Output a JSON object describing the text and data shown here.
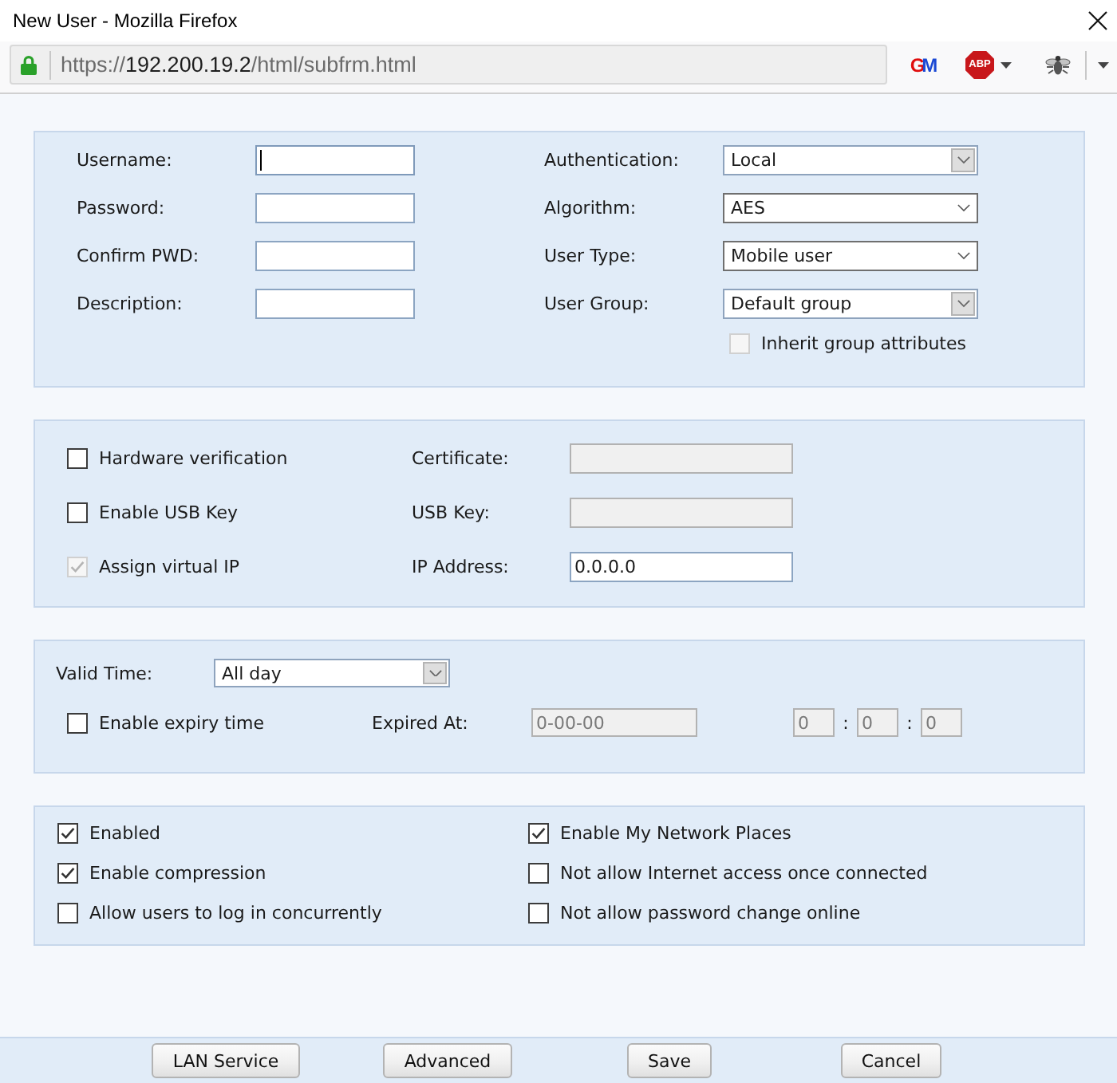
{
  "window": {
    "title": "New User - Mozilla Firefox"
  },
  "toolbar": {
    "secure": true,
    "url": {
      "scheme": "https://",
      "host": "192.200.19.2",
      "path": "/html/subfrm.html"
    },
    "extensions": [
      {
        "kind": "monogram",
        "label": "GM",
        "menu": false
      },
      {
        "kind": "badge",
        "label": "ABP",
        "menu": true
      },
      {
        "kind": "bug",
        "menu": false
      }
    ]
  },
  "account": {
    "fields": [
      {
        "label": "Username:",
        "focused": true
      },
      {
        "label": "Password:",
        "focused": false
      },
      {
        "label": "Confirm PWD:",
        "focused": false
      },
      {
        "label": "Description:",
        "focused": false
      }
    ],
    "selects": [
      {
        "label": "Authentication:",
        "value": "Local",
        "kind": "boxed"
      },
      {
        "label": "Algorithm:",
        "value": "AES",
        "kind": "plain"
      },
      {
        "label": "User Type:",
        "value": "Mobile user",
        "kind": "plain"
      },
      {
        "label": "User Group:",
        "value": "Default group",
        "kind": "boxed"
      }
    ],
    "inherit": {
      "label": "Inherit group attributes",
      "checked": false,
      "disabled": true
    }
  },
  "verification": {
    "rows": [
      {
        "option": {
          "label": "Hardware verification",
          "checked": false,
          "disabled": false
        },
        "field": {
          "label": "Certificate:",
          "disabled": true
        }
      },
      {
        "option": {
          "label": "Enable USB Key",
          "checked": false,
          "disabled": false
        },
        "field": {
          "label": "USB Key:",
          "disabled": true
        }
      },
      {
        "option": {
          "label": "Assign virtual IP",
          "checked": true,
          "disabled": true
        },
        "field": {
          "label": "IP Address:",
          "value": "0.0.0.0",
          "disabled": false
        }
      }
    ]
  },
  "validity": {
    "valid_time": {
      "label": "Valid Time:",
      "value": "All day",
      "kind": "boxed"
    },
    "expiry": {
      "label": "Enable expiry time",
      "checked": false
    },
    "expired_at": {
      "label": "Expired At:",
      "date": "0-00-00",
      "time": [
        {
          "value": "0"
        },
        {
          "separator": ":",
          "value": "0"
        },
        {
          "separator": ":",
          "value": "0"
        }
      ],
      "disabled": true
    }
  },
  "options": {
    "columns": [
      {
        "items": [
          {
            "label": "Enabled",
            "checked": true
          },
          {
            "label": "Enable compression",
            "checked": true
          },
          {
            "label": "Allow users to log in concurrently",
            "checked": false
          }
        ]
      },
      {
        "items": [
          {
            "label": "Enable My Network Places",
            "checked": true
          },
          {
            "label": "Not allow Internet access once connected",
            "checked": false
          },
          {
            "label": "Not allow password change online",
            "checked": false
          }
        ]
      }
    ]
  },
  "buttons": [
    "LAN Service",
    "Advanced",
    "Save",
    "Cancel"
  ]
}
